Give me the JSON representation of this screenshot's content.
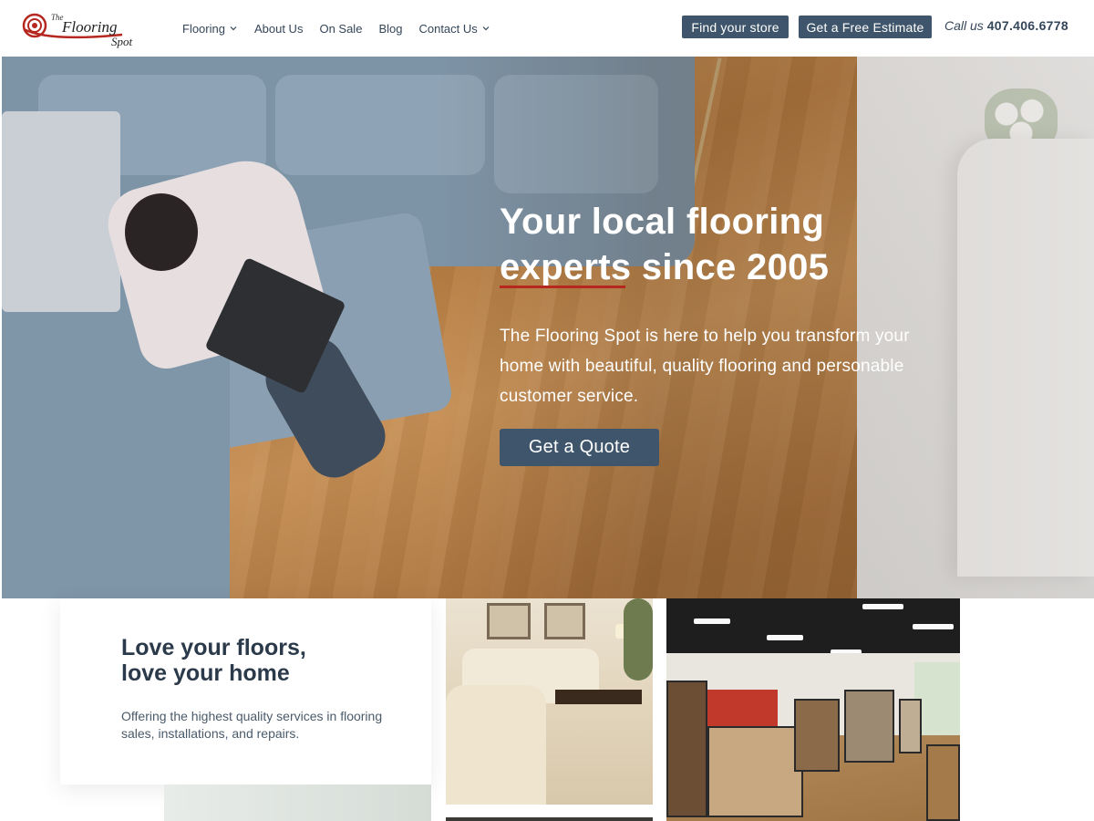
{
  "brand": {
    "logo_the": "The",
    "logo_flooring": "Flooring",
    "logo_spot": "Spot",
    "logo_color": "#b5271f"
  },
  "nav": {
    "items": [
      {
        "label": "Flooring",
        "dropdown": true
      },
      {
        "label": "About Us",
        "dropdown": false
      },
      {
        "label": "On Sale",
        "dropdown": false
      },
      {
        "label": "Blog",
        "dropdown": false
      },
      {
        "label": "Contact Us",
        "dropdown": true
      }
    ]
  },
  "header": {
    "find_store_label": "Find your store",
    "estimate_label": "Get a Free Estimate",
    "call_label": "Call us",
    "phone": "407.406.6778"
  },
  "hero": {
    "title_line1": "Your local flooring",
    "title_underlined": "experts",
    "title_rest": " since 2005",
    "description": "The Flooring Spot is here to help you transform your home with beautiful, quality flooring and personable customer service.",
    "cta_label": "Get a Quote"
  },
  "feature": {
    "title_line1": "Love your floors,",
    "title_line2": "love your home",
    "description": "Offering the highest quality services in flooring sales, installations, and repairs."
  },
  "colors": {
    "primary_button": "#3f556b",
    "text_dark": "#2b3a4a",
    "accent_red": "#b5271f"
  },
  "icons": {
    "dropdown": "chevron-down-icon"
  }
}
